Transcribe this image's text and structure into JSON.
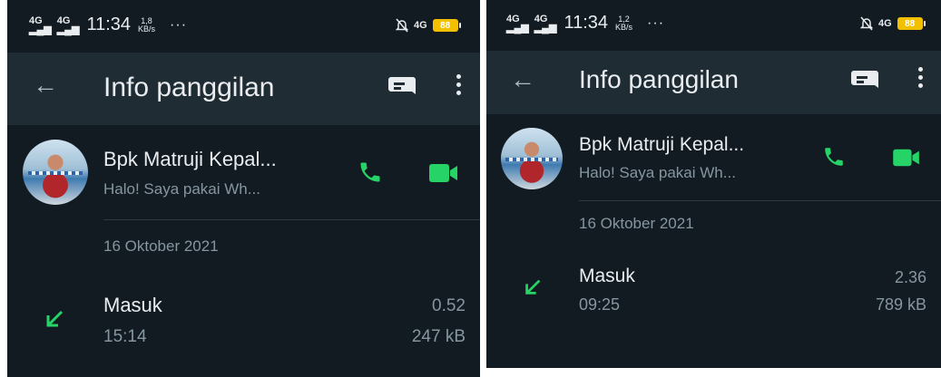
{
  "colors": {
    "accent": "#25d366",
    "background": "#121b22",
    "appbar": "#1f2c34",
    "secondary_text": "#8696a0"
  },
  "screens": [
    {
      "status": {
        "signal1": "4G",
        "signal2": "4G",
        "time": "11:34",
        "speed_value": "1,8",
        "speed_unit": "KB/s",
        "more": "···",
        "network": "4G",
        "battery": "88"
      },
      "header": {
        "back_icon": "arrow-left-icon",
        "title": "Info panggilan",
        "message_icon": "message-icon",
        "more_icon": "more-vert-icon"
      },
      "contact": {
        "name": "Bpk Matruji Kepal...",
        "status": "Halo! Saya pakai Wh...",
        "call_icon": "phone-icon",
        "video_icon": "video-icon"
      },
      "date": "16 Oktober 2021",
      "calls": [
        {
          "type": "Masuk",
          "time": "15:14",
          "duration": "0.52",
          "size": "247 kB",
          "direction_icon": "incoming-arrow-icon"
        }
      ]
    },
    {
      "status": {
        "signal1": "4G",
        "signal2": "4G",
        "time": "11:34",
        "speed_value": "1,2",
        "speed_unit": "KB/s",
        "more": "···",
        "network": "4G",
        "battery": "88"
      },
      "header": {
        "back_icon": "arrow-left-icon",
        "title": "Info panggilan",
        "message_icon": "message-icon",
        "more_icon": "more-vert-icon"
      },
      "contact": {
        "name": "Bpk Matruji Kepal...",
        "status": "Halo! Saya pakai Wh...",
        "call_icon": "phone-icon",
        "video_icon": "video-icon"
      },
      "date": "16 Oktober 2021",
      "calls": [
        {
          "type": "Masuk",
          "time": "09:25",
          "duration": "2.36",
          "size": "789 kB",
          "direction_icon": "incoming-arrow-icon"
        }
      ]
    }
  ]
}
